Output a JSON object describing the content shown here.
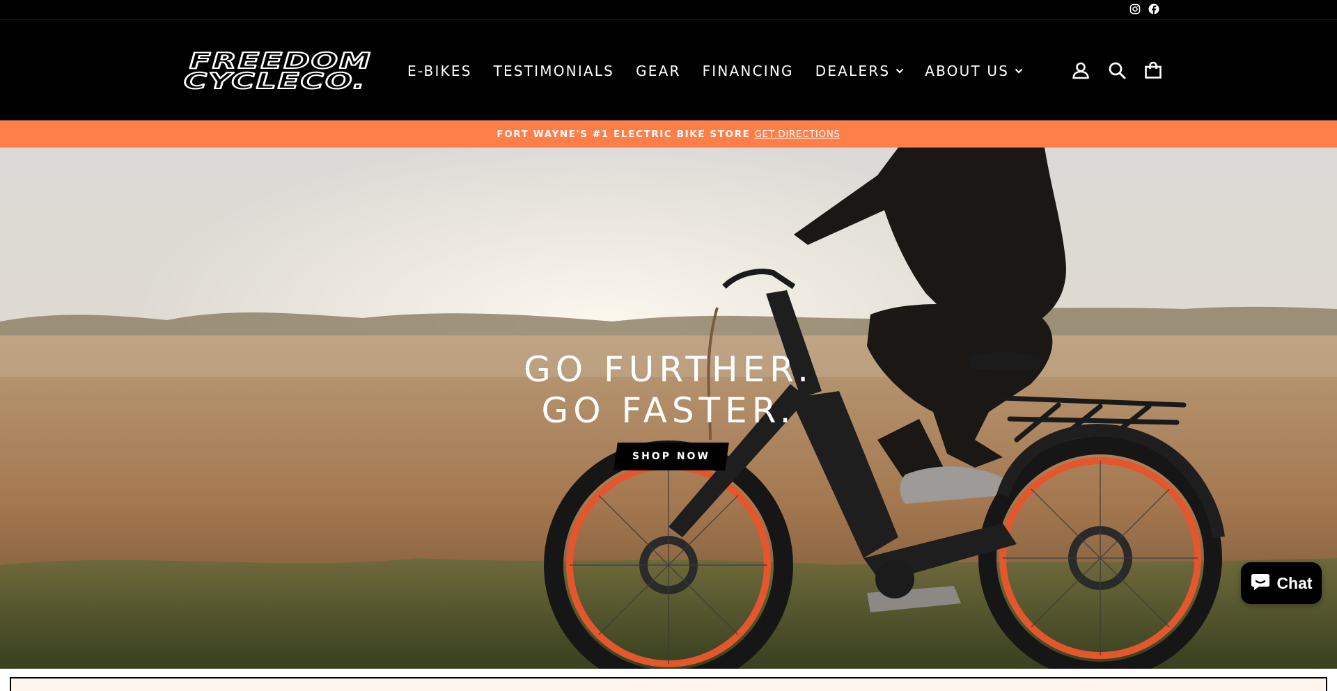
{
  "social": {
    "instagram_icon": "instagram-icon",
    "facebook_icon": "facebook-icon"
  },
  "header": {
    "logo_alt": "FREEDOM CYCLE CO.",
    "nav": [
      {
        "label": "E-BIKES",
        "has_dropdown": false
      },
      {
        "label": "TESTIMONIALS",
        "has_dropdown": false
      },
      {
        "label": "GEAR",
        "has_dropdown": false
      },
      {
        "label": "FINANCING",
        "has_dropdown": false
      },
      {
        "label": "DEALERS",
        "has_dropdown": true
      },
      {
        "label": "ABOUT US",
        "has_dropdown": true
      }
    ],
    "icons": [
      "account-icon",
      "search-icon",
      "cart-icon"
    ]
  },
  "announcement": {
    "text": "FORT WAYNE'S #1 ELECTRIC BIKE STORE",
    "link": "GET DIRECTIONS"
  },
  "hero": {
    "line1": "GO FURTHER.",
    "line2": "GO FASTER.",
    "cta": "SHOP NOW"
  },
  "chat": {
    "label": "Chat"
  },
  "colors": {
    "accent": "#ff7f4a",
    "header_bg": "#000000",
    "bottom_bg": "#fff4ec"
  }
}
